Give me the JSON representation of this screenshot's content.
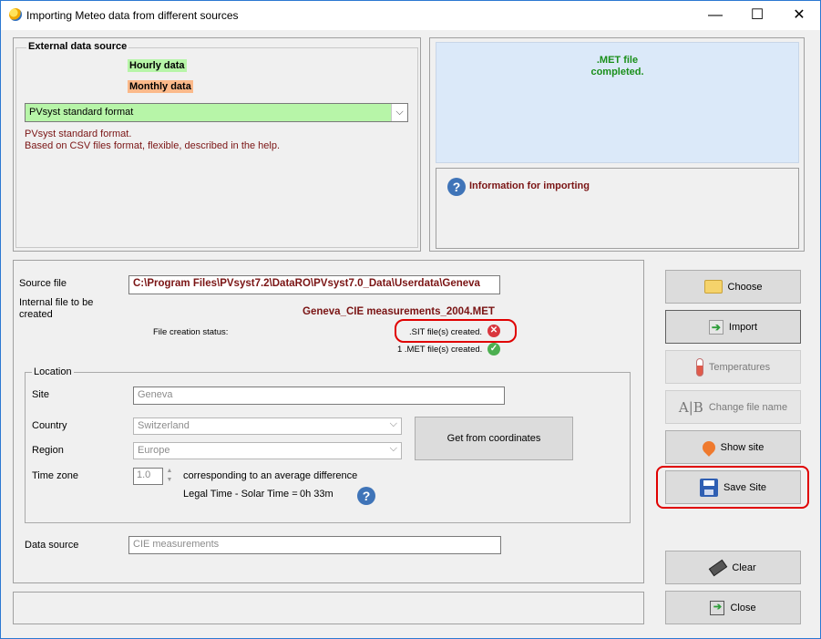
{
  "window": {
    "title": "Importing Meteo data from different sources",
    "minimize": "—",
    "maximize": "☐",
    "close": "✕"
  },
  "external_source": {
    "legend": "External data source",
    "hourly_label": "Hourly data",
    "monthly_label": "Monthly data",
    "format_selected": "PVsyst standard format",
    "description_line1": "PVsyst standard format.",
    "description_line2": "Based on CSV files format, flexible, described in the help."
  },
  "status_panel": {
    "line1": ".MET file",
    "line2": "completed."
  },
  "info_panel": {
    "title": "Information for importing"
  },
  "source": {
    "source_file_label": "Source file",
    "source_file_value": "C:\\Program Files\\PVsyst7.2\\DataRO\\PVsyst7.0_Data\\Userdata\\Geneva",
    "internal_file_label": "Internal file to be created",
    "internal_file_value": "Geneva_CIE measurements_2004.MET",
    "creation_status_label": "File creation status:",
    "sit_status": ".SIT file(s) created.",
    "met_status": "1 .MET file(s) created."
  },
  "location": {
    "legend": "Location",
    "site_label": "Site",
    "site_value": "Geneva",
    "country_label": "Country",
    "country_value": "Switzerland",
    "region_label": "Region",
    "region_value": "Europe",
    "timezone_label": "Time zone",
    "timezone_value": "1.0",
    "timezone_desc": "corresponding to an average difference",
    "legal_time_label": "Legal Time - Solar Time =",
    "legal_time_value": "0h 33m",
    "get_coords_button": "Get from coordinates"
  },
  "data_source": {
    "label": "Data source",
    "value": "CIE measurements"
  },
  "buttons": {
    "choose": "Choose",
    "import": "Import",
    "temperatures": "Temperatures",
    "change_file_name": "Change file name",
    "show_site": "Show site",
    "save_site": "Save Site",
    "clear": "Clear",
    "close": "Close"
  },
  "colors": {
    "hourly_bg": "#b7f5a8",
    "monthly_bg": "#fbb98a",
    "status_bg": "#dbe9f9",
    "status_text": "#1a8f1a",
    "dark_red": "#7a1414",
    "highlight_red": "#e00000"
  }
}
